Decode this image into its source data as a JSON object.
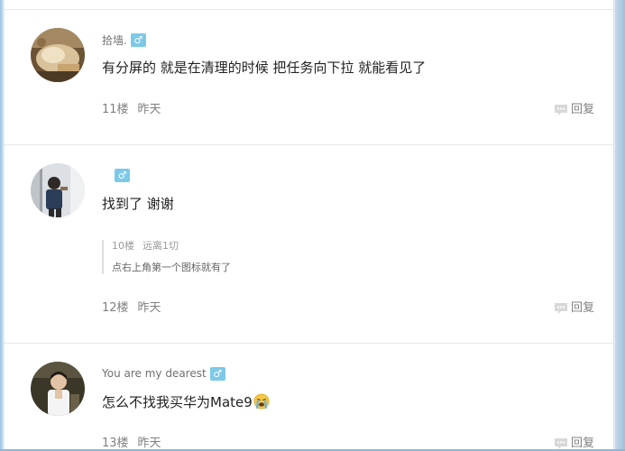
{
  "colors": {
    "gender_badge": "#7cc9e8",
    "page_edge": "#8fb7d9"
  },
  "posts": [
    {
      "username": "拾墙.",
      "gender": "♂",
      "content": "有分屏的 就是在清理的时候 把任务向下拉 就能看见了",
      "floor": "11楼",
      "time": "昨天",
      "reply_label": "回复"
    },
    {
      "username": "",
      "gender": "♂",
      "content": "找到了  谢谢",
      "quote": {
        "floor": "10楼",
        "author": "远离1切",
        "text": "点右上角第一个图标就有了"
      },
      "floor": "12楼",
      "time": "昨天",
      "reply_label": "回复"
    },
    {
      "username": "You are my dearest",
      "gender": "♂",
      "content": "怎么不找我买华为Mate9",
      "emoji": "crying-face-icon",
      "floor": "13楼",
      "time": "昨天",
      "reply_label": "回复"
    }
  ]
}
